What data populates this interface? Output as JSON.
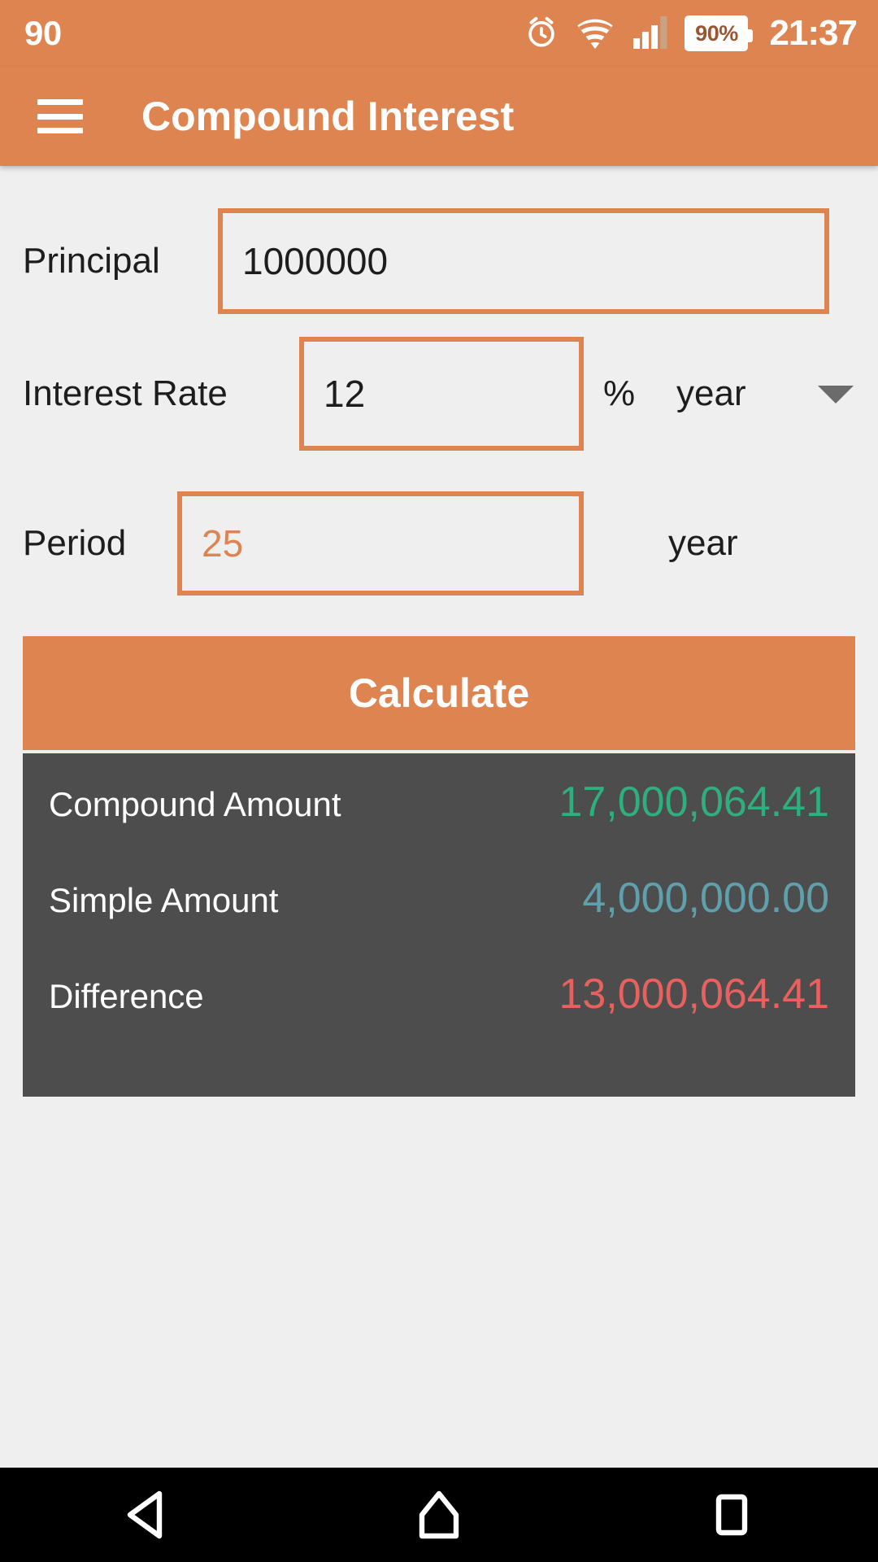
{
  "status_bar": {
    "left_text": "90",
    "alarm_icon": "alarm-clock-icon",
    "wifi_icon": "wifi-icon",
    "signal_icon": "cellular-signal-icon",
    "battery_level": "90%",
    "time": "21:37"
  },
  "app_bar": {
    "menu_icon": "hamburger-menu-icon",
    "title": "Compound Interest"
  },
  "form": {
    "principal": {
      "label": "Principal",
      "value": "1000000",
      "is_placeholder": false
    },
    "interest_rate": {
      "label": "Interest Rate",
      "value": "12",
      "is_placeholder": false,
      "percent_symbol": "%",
      "period_unit": "year",
      "dropdown_icon": "chevron-down-icon"
    },
    "period": {
      "label": "Period",
      "value": "25",
      "is_placeholder": true,
      "unit": "year"
    },
    "calculate_label": "Calculate"
  },
  "results": {
    "rows": [
      {
        "label": "Compound Amount",
        "value": "17,000,064.41",
        "color": "#2FAF7E"
      },
      {
        "label": "Simple Amount",
        "value": "4,000,000.00",
        "color": "#5FA0AC"
      },
      {
        "label": "Difference",
        "value": "13,000,064.41",
        "color": "#E8615F"
      }
    ]
  },
  "nav_bar": {
    "back": "back-triangle-icon",
    "home": "home-icon",
    "recents": "recents-square-icon"
  },
  "colors": {
    "accent_orange": "#DE8450",
    "page_background": "#EFEFEF",
    "results_background": "#4D4D4D",
    "compound_green": "#2FAF7E",
    "simple_teal": "#5FA0AC",
    "difference_red": "#E8615F"
  }
}
